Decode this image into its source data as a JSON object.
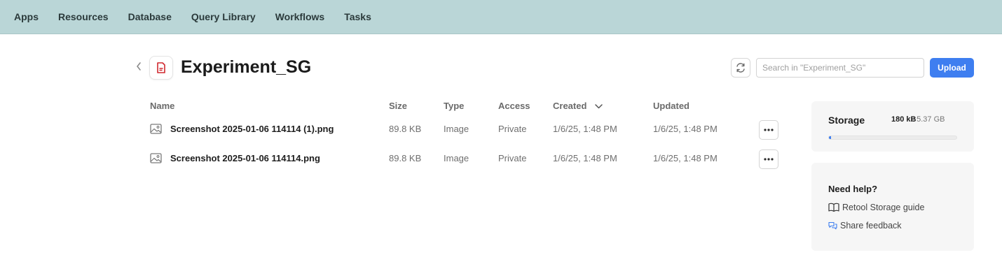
{
  "nav": {
    "items": [
      "Apps",
      "Resources",
      "Database",
      "Query Library",
      "Workflows",
      "Tasks"
    ]
  },
  "header": {
    "title": "Experiment_SG",
    "search_placeholder": "Search in \"Experiment_SG\"",
    "upload_label": "Upload"
  },
  "table": {
    "columns": {
      "name": "Name",
      "size": "Size",
      "type": "Type",
      "access": "Access",
      "created": "Created",
      "updated": "Updated"
    },
    "rows": [
      {
        "name": "Screenshot 2025-01-06 114114 (1).png",
        "size": "89.8 KB",
        "type": "Image",
        "access": "Private",
        "created": "1/6/25, 1:48 PM",
        "updated": "1/6/25, 1:48 PM"
      },
      {
        "name": "Screenshot 2025-01-06 114114.png",
        "size": "89.8 KB",
        "type": "Image",
        "access": "Private",
        "created": "1/6/25, 1:48 PM",
        "updated": "1/6/25, 1:48 PM"
      }
    ]
  },
  "storage": {
    "label": "Storage",
    "used": "180 kB",
    "total": "/ 5.37 GB",
    "used_fraction": 0.0033,
    "accent_color": "#3e7ef0"
  },
  "help": {
    "title": "Need help?",
    "links": [
      "Retool Storage guide",
      "Share feedback"
    ]
  },
  "icons": {
    "back": "chevron-left-icon",
    "file": "file-icon",
    "refresh": "refresh-icon",
    "image": "image-icon",
    "more": "more-horizontal-icon",
    "book": "book-icon",
    "feedback": "chat-bubbles-icon",
    "sort": "chevron-down-icon"
  }
}
